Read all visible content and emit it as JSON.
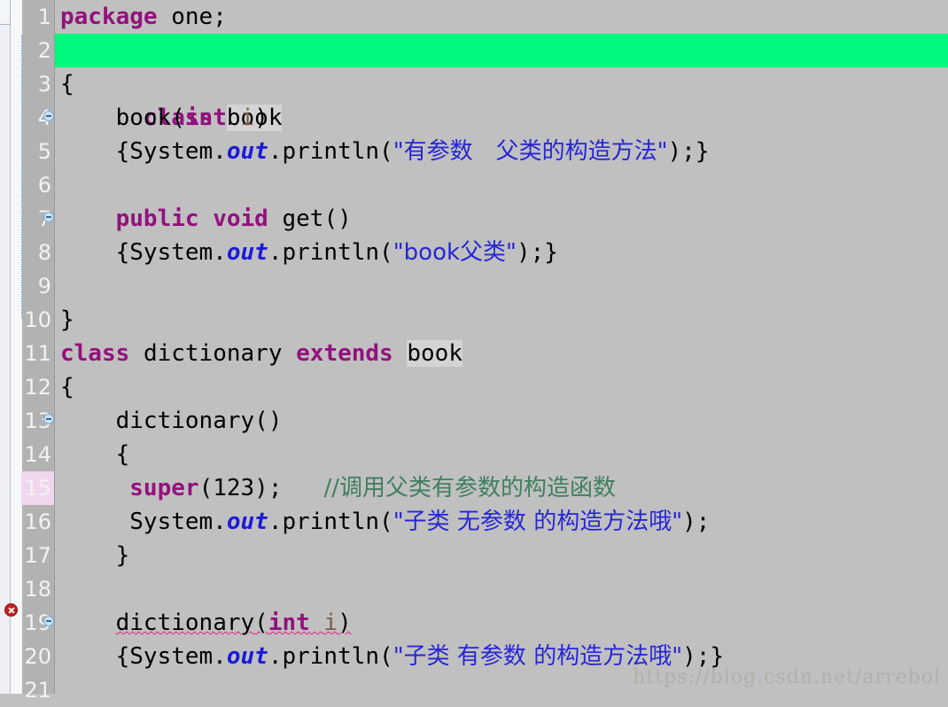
{
  "editor": {
    "kind": "java-source-editor",
    "background_color": "#c0c0c0",
    "gutter_color": "#b2b2b2",
    "highlight_color": "#00f87c",
    "occurrence_color": "#d4d4d4",
    "modified_line_color": "#f0d7ee",
    "keyword_color": "#93117d",
    "string_color": "#2626d6",
    "comment_color": "#3f7f5f",
    "field_color": "#1b1bd8",
    "parameter_color": "#7d5c4a",
    "error_underline_color": "#e0218a"
  },
  "gutter": {
    "line_numbers": [
      "1",
      "2",
      "3",
      "4",
      "5",
      "6",
      "7",
      "8",
      "9",
      "10",
      "11",
      "12",
      "13",
      "14",
      "15",
      "16",
      "17",
      "18",
      "19",
      "20",
      "21"
    ],
    "modified_lines": [
      "15"
    ],
    "fold_marker_lines": [
      "4",
      "7",
      "13",
      "19"
    ],
    "error_marker_lines": [
      "19"
    ],
    "fold_rule_after_line": "3"
  },
  "code": {
    "lines": [
      {
        "n": "1",
        "text": "package one;"
      },
      {
        "n": "2",
        "text": "class book"
      },
      {
        "n": "3",
        "text": "{"
      },
      {
        "n": "4",
        "text": "    book(int i)"
      },
      {
        "n": "5",
        "text": "    {System.out.println(\"有参数　父类的构造方法\");}"
      },
      {
        "n": "6",
        "text": ""
      },
      {
        "n": "7",
        "text": "    public void get()"
      },
      {
        "n": "8",
        "text": "    {System.out.println(\"book父类\");}"
      },
      {
        "n": "9",
        "text": ""
      },
      {
        "n": "10",
        "text": "}"
      },
      {
        "n": "11",
        "text": "class dictionary extends book"
      },
      {
        "n": "12",
        "text": "{"
      },
      {
        "n": "13",
        "text": "    dictionary()"
      },
      {
        "n": "14",
        "text": "    {"
      },
      {
        "n": "15",
        "text": "     super(123);   //调用父类有参数的构造函数"
      },
      {
        "n": "16",
        "text": "     System.out.println(\"子类 无参数 的构造方法哦\");"
      },
      {
        "n": "17",
        "text": "    }"
      },
      {
        "n": "18",
        "text": ""
      },
      {
        "n": "19",
        "text": "    dictionary(int i)"
      },
      {
        "n": "20",
        "text": "    {System.out.println(\"子类 有参数 的构造方法哦\");}"
      },
      {
        "n": "21",
        "text": ""
      }
    ],
    "tokens": {
      "kw_package": "package",
      "kw_class": "class",
      "kw_public": "public",
      "kw_void": "void",
      "kw_int": "int",
      "kw_extends": "extends",
      "kw_super": "super",
      "id_one": " one;",
      "id_book": "book",
      "id_dictionary": "dictionary",
      "field_out": "out",
      "str_line5": "\"有参数　父类的构造方法\"",
      "str_line8": "\"book父类\"",
      "str_line16": "\"子类 无参数 的构造方法哦\"",
      "str_line20": "\"子类 有参数 的构造方法哦\"",
      "comment_line15": "//调用父类有参数的构造函数"
    }
  },
  "watermark": {
    "text": "https://blog.csdn.net/arrebol"
  }
}
